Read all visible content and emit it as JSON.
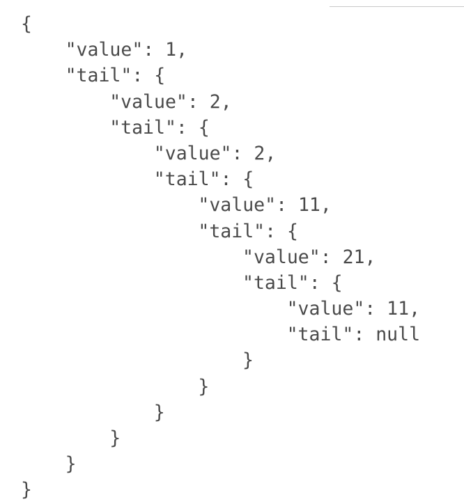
{
  "code": {
    "lines": [
      {
        "indent": 0,
        "text": "{"
      },
      {
        "indent": 1,
        "text": "\"value\": 1,"
      },
      {
        "indent": 1,
        "text": "\"tail\": {"
      },
      {
        "indent": 2,
        "text": "\"value\": 2,"
      },
      {
        "indent": 2,
        "text": "\"tail\": {"
      },
      {
        "indent": 3,
        "text": "\"value\": 2,"
      },
      {
        "indent": 3,
        "text": "\"tail\": {"
      },
      {
        "indent": 4,
        "text": "\"value\": 11,"
      },
      {
        "indent": 4,
        "text": "\"tail\": {"
      },
      {
        "indent": 5,
        "text": "\"value\": 21,"
      },
      {
        "indent": 5,
        "text": "\"tail\": {"
      },
      {
        "indent": 6,
        "text": "\"value\": 11,"
      },
      {
        "indent": 6,
        "text": "\"tail\": null"
      },
      {
        "indent": 5,
        "text": "}"
      },
      {
        "indent": 4,
        "text": "}"
      },
      {
        "indent": 3,
        "text": "}"
      },
      {
        "indent": 2,
        "text": "}"
      },
      {
        "indent": 1,
        "text": "}"
      },
      {
        "indent": 0,
        "text": "}"
      }
    ]
  }
}
